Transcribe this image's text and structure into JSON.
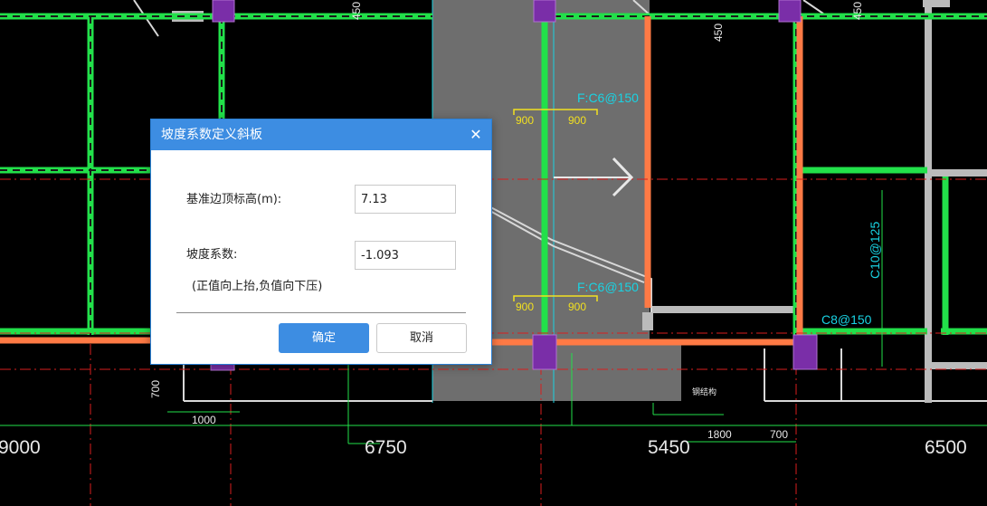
{
  "canvas": {
    "dimension_labels": [
      "9000",
      "6750",
      "5450",
      "6500"
    ],
    "small_dims": [
      "450",
      "450",
      "450",
      "700",
      "1000",
      "1800",
      "700"
    ],
    "rebar_labels": [
      "F:C6@150",
      "F:C6@150",
      "C10@125",
      "C8@150"
    ],
    "span_labels": [
      "900",
      "900",
      "900",
      "900"
    ],
    "misc_label": "钢结构"
  },
  "dialog": {
    "title": "坡度系数定义斜板",
    "close_glyph": "✕",
    "base_label": "基准边顶标高(m):",
    "base_value": "7.13",
    "slope_label": "坡度系数:",
    "slope_value": "-1.093",
    "hint": "(正值向上抬,负值向下压)",
    "ok_label": "确定",
    "cancel_label": "取消"
  },
  "colors": {
    "dialog_accent": "#3d8de2",
    "beam_green": "#22e04a",
    "beam_orange": "#ff7a45",
    "column_purple": "#7a2ea8",
    "slab_gray": "#6e6e6e",
    "axis_red": "#d81e1e",
    "text_cyan": "#19d3e3"
  }
}
